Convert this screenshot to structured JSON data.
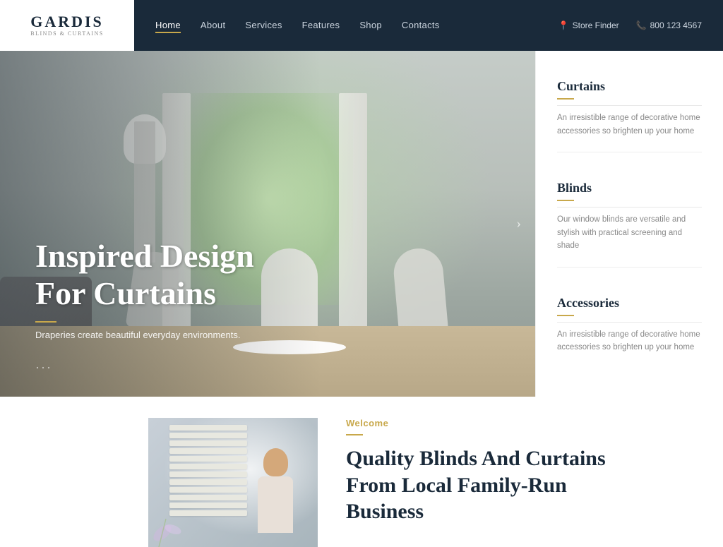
{
  "logo": {
    "name": "GARDIS",
    "sub": "Blinds & Curtains"
  },
  "nav": {
    "links": [
      {
        "label": "Home",
        "active": true
      },
      {
        "label": "About",
        "active": false
      },
      {
        "label": "Services",
        "active": false
      },
      {
        "label": "Features",
        "active": false
      },
      {
        "label": "Shop",
        "active": false
      },
      {
        "label": "Contacts",
        "active": false
      }
    ],
    "store_finder": "Store Finder",
    "phone": "800 123 4567"
  },
  "hero": {
    "title": "Inspired Design For Curtains",
    "subtitle": "Draperies create beautiful everyday environments.",
    "dots": "···"
  },
  "sidebar": {
    "panels": [
      {
        "title": "Curtains",
        "text": "An irresistible range of decorative home accessories so brighten up your home"
      },
      {
        "title": "Blinds",
        "text": "Our window blinds are versatile and stylish with practical screening and shade"
      },
      {
        "title": "Accessories",
        "text": "An irresistible range of decorative home accessories so brighten up your home"
      }
    ]
  },
  "bottom": {
    "welcome_label": "Welcome",
    "title_line1": "Quality Blinds And Curtains",
    "title_line2": "From Local Family-Run",
    "title_line3": "Business"
  },
  "colors": {
    "accent": "#c8a84b",
    "dark_navy": "#1a2a3a",
    "light_text": "#888888"
  }
}
